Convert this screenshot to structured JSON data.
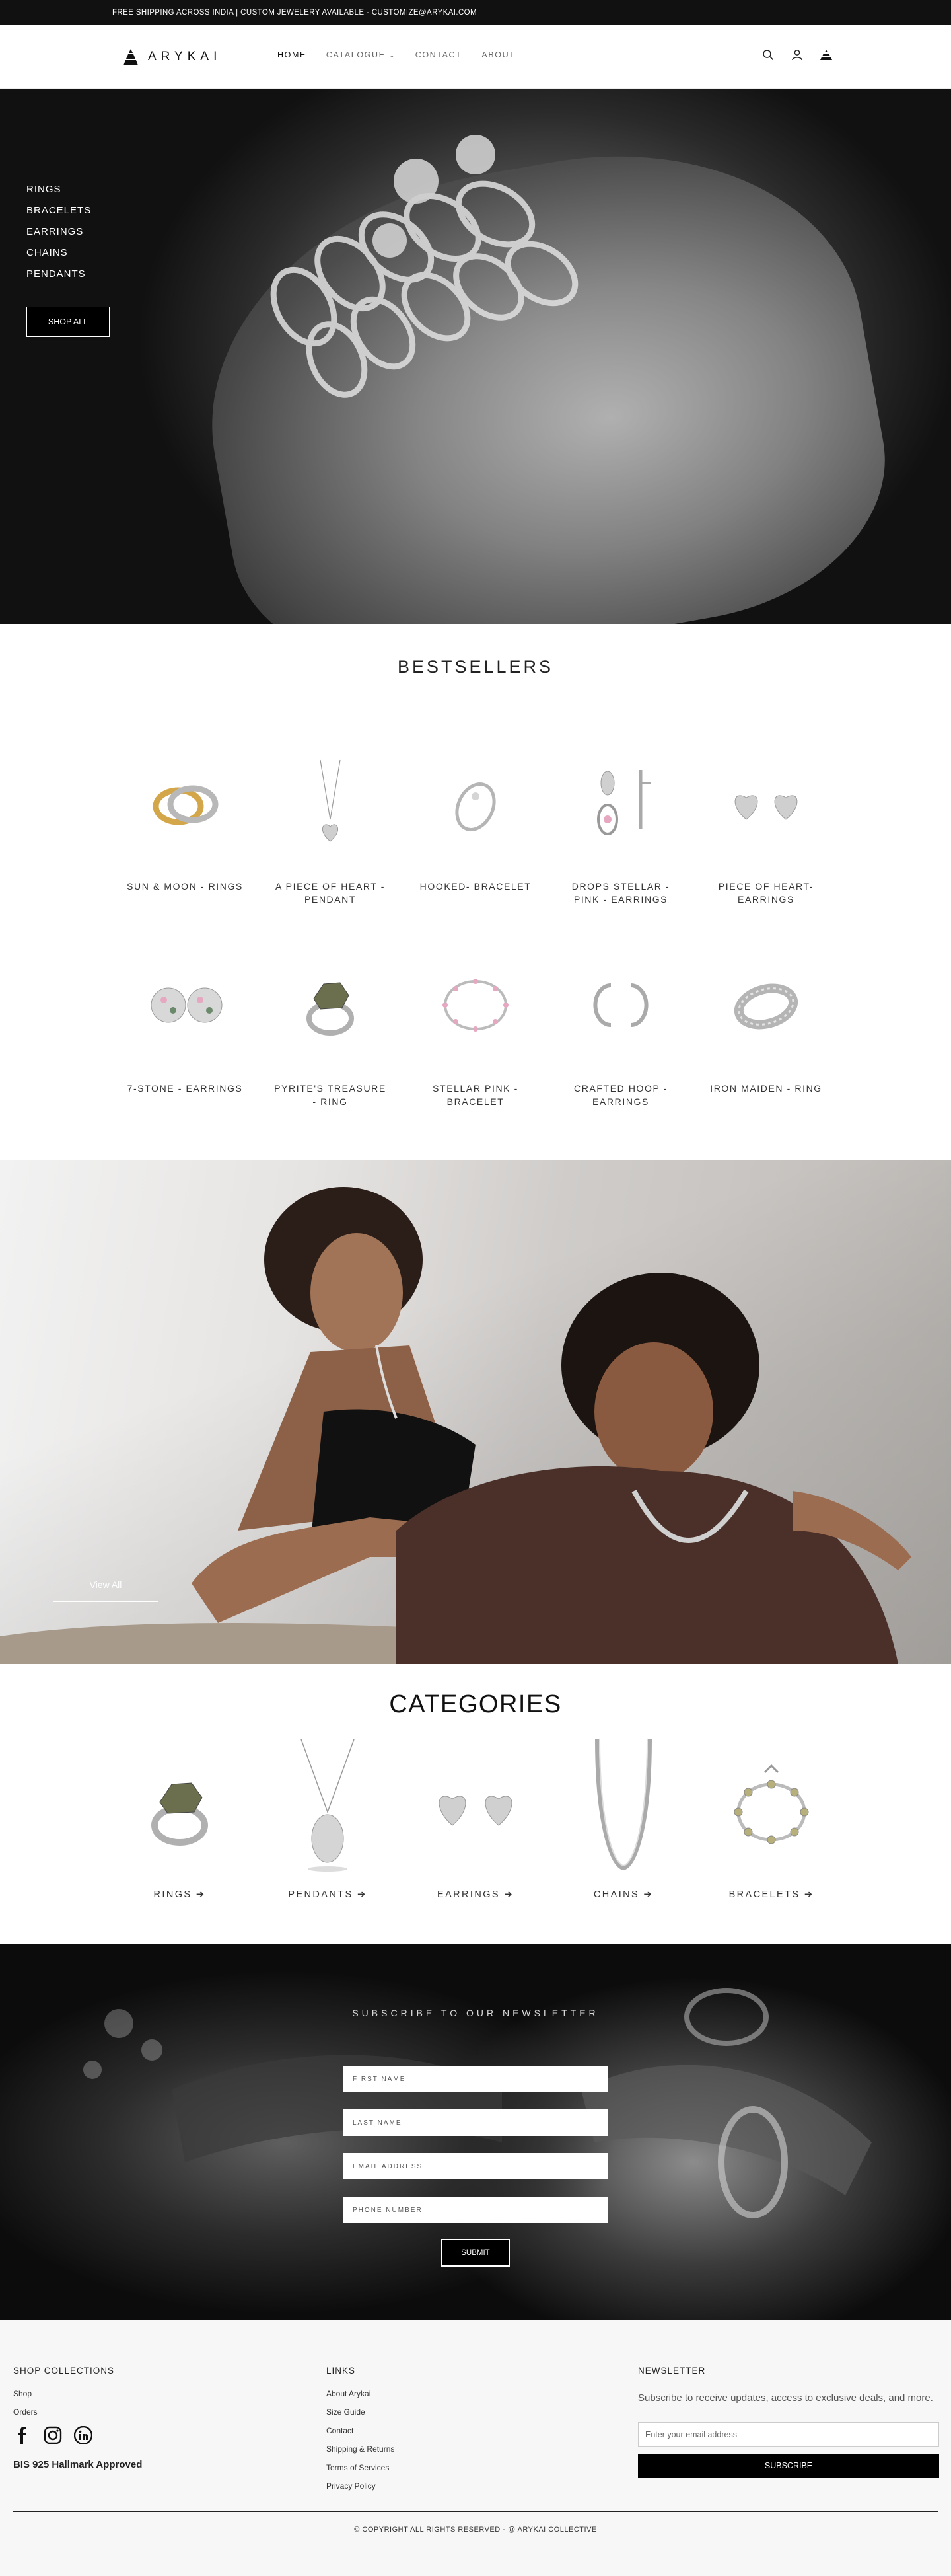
{
  "announcement": "FREE SHIPPING ACROSS INDIA | CUSTOM JEWELERY AVAILABLE - CUSTOMIZE@ARYKAI.COM",
  "brand": "ARYKAI",
  "nav": {
    "home": "HOME",
    "catalogue": "CATALOGUE",
    "contact": "CONTACT",
    "about": "ABOUT"
  },
  "hero": {
    "menu": [
      "RINGS",
      "BRACELETS",
      "EARRINGS",
      "CHAINS",
      "PENDANTS"
    ],
    "cta": "SHOP ALL"
  },
  "bestsellers": {
    "title": "BESTSELLERS",
    "row1": [
      {
        "name": "SUN & MOON - RINGS",
        "icon": "rings-icon"
      },
      {
        "name": "A PIECE OF HEART - PENDANT",
        "icon": "heart-pendant-icon"
      },
      {
        "name": "HOOKED- BRACELET",
        "icon": "bangle-icon"
      },
      {
        "name": "DROPS STELLAR - PINK - EARRINGS",
        "icon": "drop-earrings-icon"
      },
      {
        "name": "PIECE OF HEART- EARRINGS",
        "icon": "heart-earrings-icon"
      }
    ],
    "row2": [
      {
        "name": "7-STONE - EARRINGS",
        "icon": "stone-earrings-icon"
      },
      {
        "name": "PYRITE'S TREASURE - RING",
        "icon": "pyrite-ring-icon"
      },
      {
        "name": "STELLAR PINK - BRACELET",
        "icon": "pink-bracelet-icon"
      },
      {
        "name": "CRAFTED HOOP - EARRINGS",
        "icon": "hoop-earrings-icon"
      },
      {
        "name": "IRON MAIDEN - RING",
        "icon": "band-ring-icon"
      }
    ]
  },
  "feature": {
    "cta": "View All"
  },
  "categories": {
    "title": "CATEGORIES",
    "items": [
      "RINGS",
      "PENDANTS",
      "EARRINGS",
      "CHAINS",
      "BRACELETS"
    ]
  },
  "newsletter": {
    "title": "SUBSCRIBE TO OUR NEWSLETTER",
    "fields": [
      "FIRST NAME",
      "LAST NAME",
      "EMAIL ADDRESS",
      "PHONE NUMBER"
    ],
    "submit": "SUBMIT"
  },
  "footer": {
    "shop_title": "SHOP COLLECTIONS",
    "shop_links": [
      "Shop",
      "Orders"
    ],
    "bis": "BIS 925 Hallmark Approved",
    "links_title": "LINKS",
    "links": [
      "About Arykai",
      "Size Guide",
      "Contact",
      "Shipping & Returns",
      "Terms of Services",
      "Privacy Policy"
    ],
    "nl_title": "NEWSLETTER",
    "nl_text": "Subscribe to receive updates, access to exclusive deals, and more.",
    "nl_placeholder": "Enter your email address",
    "nl_button": "SUBSCRIBE",
    "copyright": "© COPYRIGHT ALL RIGHTS RESERVED - @ ARYKAI COLLECTIVE"
  },
  "colors": {
    "primary": "#000000",
    "background": "#ffffff",
    "footer_bg": "#f7f7f7",
    "accent_gold": "#d4a64a",
    "pink_stone": "#e6a8c0",
    "pyrite": "#6b6f4d"
  }
}
